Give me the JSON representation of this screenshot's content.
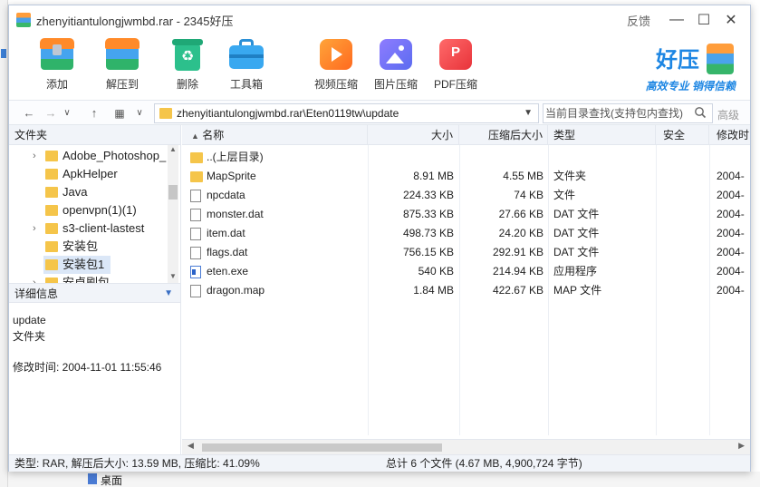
{
  "window": {
    "title": "zhenyitiantulongjwmbd.rar - 2345好压",
    "feedback": "反馈",
    "minimize": "—",
    "maximize": "☐",
    "close": "✕"
  },
  "toolbar": {
    "add": "添加",
    "extract": "解压到",
    "delete": "删除",
    "toolbox": "工具箱",
    "video": "视频压缩",
    "image": "图片压缩",
    "pdf": "PDF压缩"
  },
  "brand": {
    "name": "好压",
    "slogan": "高效专业 销得信赖"
  },
  "addressbar": {
    "path": "zhenyitiantulongjwmbd.rar\\Eten0119tw\\update",
    "search_placeholder": "当前目录查找(支持包内查找)",
    "restore": "高级"
  },
  "left_panel": {
    "header": "文件夹",
    "tree": [
      {
        "label": "Adobe_Photoshop_",
        "has_arrow": true
      },
      {
        "label": "ApkHelper",
        "has_arrow": false
      },
      {
        "label": "Java",
        "has_arrow": false
      },
      {
        "label": "openvpn(1)(1)",
        "has_arrow": false
      },
      {
        "label": "s3-client-lastest",
        "has_arrow": true
      },
      {
        "label": "安装包",
        "has_arrow": false
      },
      {
        "label": "安装包1",
        "has_arrow": false
      },
      {
        "label": "安卓刷包",
        "has_arrow": true
      }
    ],
    "details_header": "详细信息",
    "details": {
      "name": "update",
      "type": "文件夹",
      "modified": "修改时间: 2004-11-01 11:55:46"
    }
  },
  "columns": {
    "name": "名称",
    "size": "大小",
    "packed": "压缩后大小",
    "type": "类型",
    "security": "安全",
    "modified": "修改时"
  },
  "files": [
    {
      "icon": "folder",
      "name": "..(上层目录)",
      "size": "",
      "packed": "",
      "type": "",
      "modified": ""
    },
    {
      "icon": "folder",
      "name": "MapSprite",
      "size": "8.91 MB",
      "packed": "4.55 MB",
      "type": "文件夹",
      "modified": "2004-"
    },
    {
      "icon": "doc",
      "name": "npcdata",
      "size": "224.33 KB",
      "packed": "74 KB",
      "type": "文件",
      "modified": "2004-"
    },
    {
      "icon": "doc",
      "name": "monster.dat",
      "size": "875.33 KB",
      "packed": "27.66 KB",
      "type": "DAT 文件",
      "modified": "2004-"
    },
    {
      "icon": "doc",
      "name": "item.dat",
      "size": "498.73 KB",
      "packed": "24.20 KB",
      "type": "DAT 文件",
      "modified": "2004-"
    },
    {
      "icon": "doc",
      "name": "flags.dat",
      "size": "756.15 KB",
      "packed": "292.91 KB",
      "type": "DAT 文件",
      "modified": "2004-"
    },
    {
      "icon": "exe",
      "name": "eten.exe",
      "size": "540 KB",
      "packed": "214.94 KB",
      "type": "应用程序",
      "modified": "2004-"
    },
    {
      "icon": "doc",
      "name": "dragon.map",
      "size": "1.84 MB",
      "packed": "422.67 KB",
      "type": "MAP 文件",
      "modified": "2004-"
    }
  ],
  "status": {
    "left": "类型: RAR, 解压后大小: 13.59 MB, 压缩比: 41.09%",
    "right": "总计 6 个文件 (4.67 MB, 4,900,724 字节)"
  },
  "background": {
    "bottom_text": "桌面"
  },
  "colors": {
    "accent": "#1d86e3",
    "folder": "#f5c54a",
    "selection": "#dbe7f7"
  }
}
